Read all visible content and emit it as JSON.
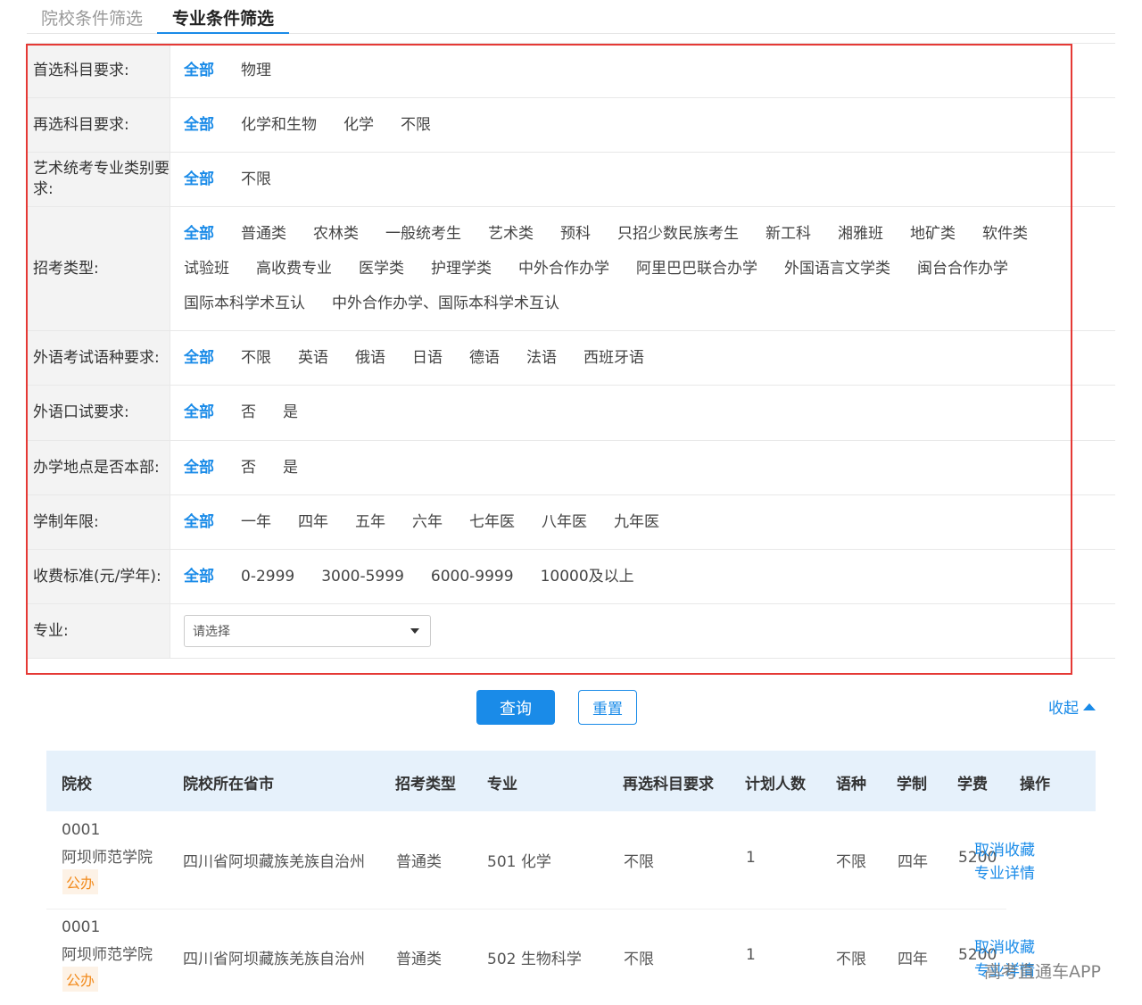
{
  "tabs": {
    "school": "院校条件筛选",
    "major": "专业条件筛选"
  },
  "filters": [
    {
      "label": "首选科目要求:",
      "options": [
        "全部",
        "物理"
      ]
    },
    {
      "label": "再选科目要求:",
      "options": [
        "全部",
        "化学和生物",
        "化学",
        "不限"
      ]
    },
    {
      "label": "艺术统考专业类别要求:",
      "options": [
        "全部",
        "不限"
      ]
    },
    {
      "label": "招考类型:",
      "options": [
        "全部",
        "普通类",
        "农林类",
        "一般统考生",
        "艺术类",
        "预科",
        "只招少数民族考生",
        "新工科",
        "湘雅班",
        "地矿类",
        "软件类",
        "试验班",
        "高收费专业",
        "医学类",
        "护理学类",
        "中外合作办学",
        "阿里巴巴联合办学",
        "外国语言文学类",
        "闽台合作办学",
        "国际本科学术互认",
        "中外合作办学、国际本科学术互认"
      ]
    },
    {
      "label": "外语考试语种要求:",
      "options": [
        "全部",
        "不限",
        "英语",
        "俄语",
        "日语",
        "德语",
        "法语",
        "西班牙语"
      ]
    },
    {
      "label": "外语口试要求:",
      "options": [
        "全部",
        "否",
        "是"
      ]
    },
    {
      "label": "办学地点是否本部:",
      "options": [
        "全部",
        "否",
        "是"
      ]
    },
    {
      "label": "学制年限:",
      "options": [
        "全部",
        "一年",
        "四年",
        "五年",
        "六年",
        "七年医",
        "八年医",
        "九年医"
      ]
    },
    {
      "label": "收费标准(元/学年):",
      "options": [
        "全部",
        "0-2999",
        "3000-5999",
        "6000-9999",
        "10000及以上"
      ]
    }
  ],
  "major_filter": {
    "label": "专业:",
    "placeholder": "请选择"
  },
  "buttons": {
    "query": "查询",
    "reset": "重置",
    "collapse": "收起"
  },
  "table": {
    "headers": [
      "院校",
      "院校所在省市",
      "招考类型",
      "专业",
      "再选科目要求",
      "计划人数",
      "语种",
      "学制",
      "学费",
      "操作"
    ],
    "rows": [
      {
        "code": "0001",
        "school": "阿坝师范学院",
        "badge": "公办",
        "province": "四川省阿坝藏族羌族自治州",
        "type": "普通类",
        "major": "501 化学",
        "subject": "不限",
        "plan": "1",
        "language": "不限",
        "duration": "四年",
        "fee": "5200",
        "actions": [
          "取消收藏",
          "专业详情"
        ]
      },
      {
        "code": "0001",
        "school": "阿坝师范学院",
        "badge": "公办",
        "province": "四川省阿坝藏族羌族自治州",
        "type": "普通类",
        "major": "502 生物科学",
        "subject": "不限",
        "plan": "1",
        "language": "不限",
        "duration": "四年",
        "fee": "5200",
        "actions": [
          "取消收藏",
          "专业详情"
        ]
      }
    ]
  },
  "watermark": "高考直通车APP"
}
